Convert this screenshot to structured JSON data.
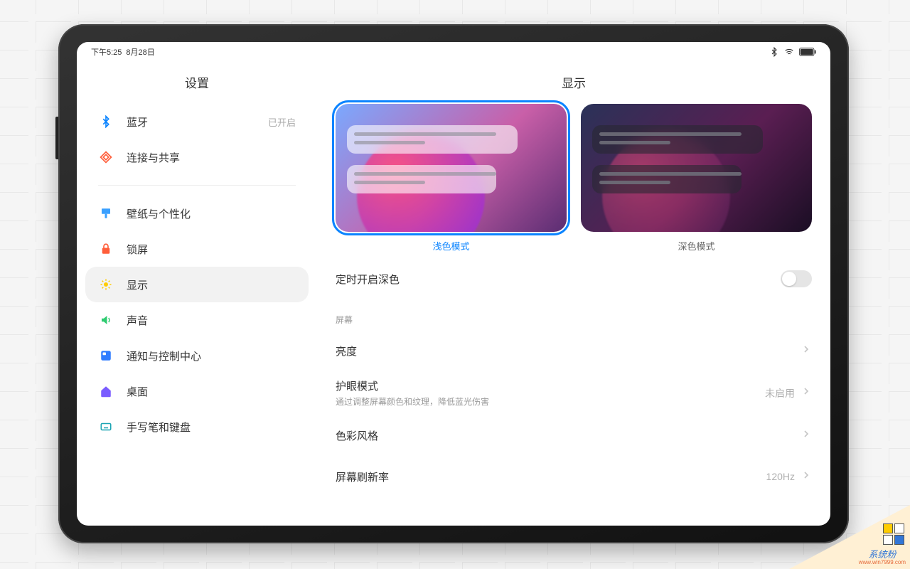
{
  "status": {
    "time": "下午5:25",
    "date": "8月28日"
  },
  "sidebar": {
    "title": "设置",
    "items": [
      {
        "id": "bluetooth",
        "label": "蓝牙",
        "value": "已开启",
        "iconColor": "#0b84ff"
      },
      {
        "id": "connect-share",
        "label": "连接与共享",
        "value": "",
        "iconColor": "#ff5e3a"
      }
    ],
    "items2": [
      {
        "id": "wallpaper",
        "label": "壁纸与个性化",
        "iconColor": "#3aa0ff"
      },
      {
        "id": "lockscreen",
        "label": "锁屏",
        "iconColor": "#ff5e3a"
      },
      {
        "id": "display",
        "label": "显示",
        "iconColor": "#ffcc00",
        "active": true
      },
      {
        "id": "sound",
        "label": "声音",
        "iconColor": "#2ecb70"
      },
      {
        "id": "notifications",
        "label": "通知与控制中心",
        "iconColor": "#2f7cff"
      },
      {
        "id": "home",
        "label": "桌面",
        "iconColor": "#7a5cff"
      },
      {
        "id": "stylus-keyboard",
        "label": "手写笔和键盘",
        "iconColor": "#1aa4b3"
      }
    ]
  },
  "detail": {
    "title": "显示",
    "themes": {
      "light": "浅色模式",
      "dark": "深色模式"
    },
    "scheduleDark": {
      "label": "定时开启深色",
      "on": false
    },
    "sectionScreen": "屏幕",
    "brightness": {
      "label": "亮度"
    },
    "eyeMode": {
      "label": "护眼模式",
      "sub": "通过调整屏幕颜色和纹理，降低蓝光伤害",
      "value": "未启用"
    },
    "colorStyle": {
      "label": "色彩风格"
    },
    "refreshRate": {
      "label": "屏幕刷新率",
      "value": "120Hz"
    }
  },
  "watermark": {
    "brand": "系统粉",
    "url": "www.win7999.com"
  }
}
